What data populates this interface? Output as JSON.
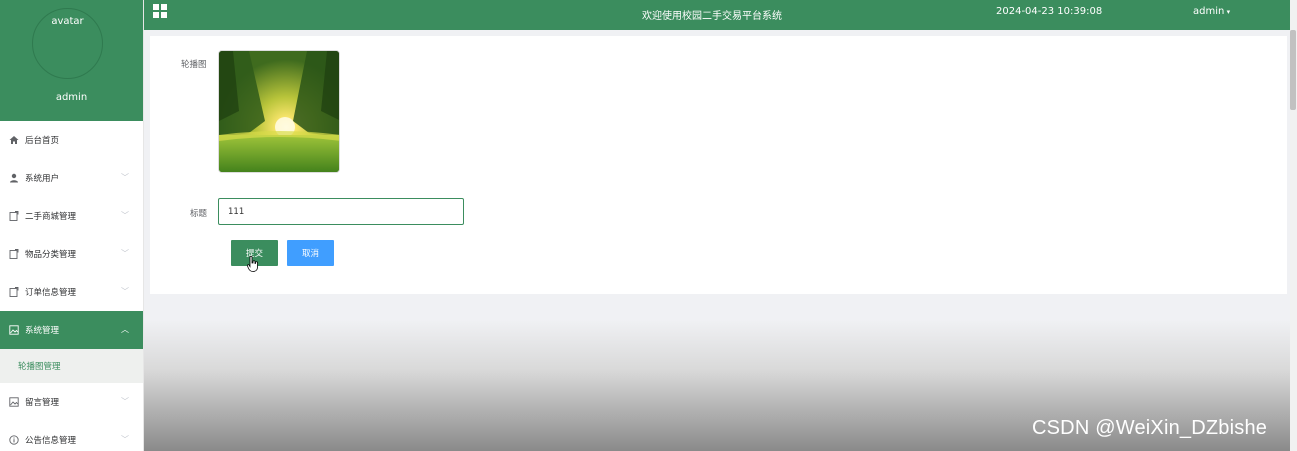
{
  "sidebar": {
    "avatar_label": "avatar",
    "username": "admin",
    "items": [
      {
        "label": "后台首页",
        "icon": "home-icon",
        "has_chevron": false
      },
      {
        "label": "系统用户",
        "icon": "user-icon",
        "has_chevron": true
      },
      {
        "label": "二手商城管理",
        "icon": "doc-icon",
        "has_chevron": true
      },
      {
        "label": "物品分类管理",
        "icon": "doc-icon",
        "has_chevron": true
      },
      {
        "label": "订单信息管理",
        "icon": "doc-icon",
        "has_chevron": true
      },
      {
        "label": "系统管理",
        "icon": "picture-icon",
        "has_chevron": true,
        "active": true
      },
      {
        "label": "留言管理",
        "icon": "picture-icon",
        "has_chevron": true
      },
      {
        "label": "公告信息管理",
        "icon": "info-icon",
        "has_chevron": true
      }
    ],
    "sub_item": "轮播图管理"
  },
  "header": {
    "title": "欢迎使用校园二手交易平台系统",
    "datetime": "2024-04-23 10:39:08",
    "user": "admin"
  },
  "form": {
    "image_label": "轮播图",
    "title_label": "标题",
    "title_value": "111",
    "submit_label": "提交",
    "cancel_label": "取消"
  },
  "watermark": "CSDN @WeiXin_DZbishe",
  "colors": {
    "primary_green": "#3b8d5e",
    "cancel_blue": "#409eff"
  }
}
